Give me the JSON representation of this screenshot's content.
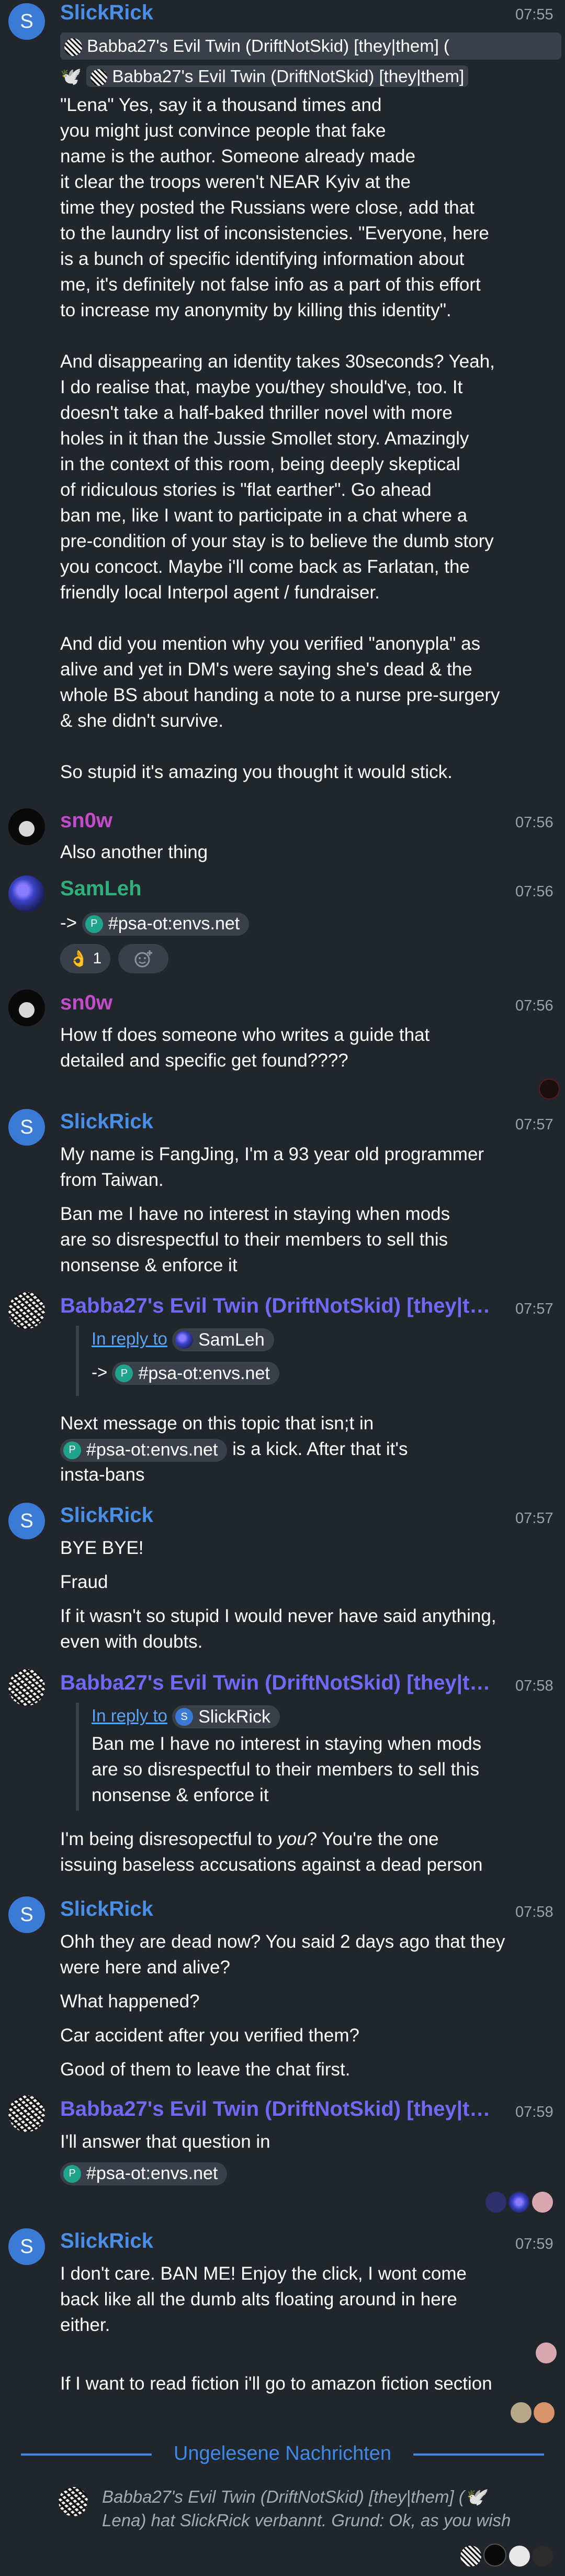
{
  "messages": {
    "m1": {
      "sender": "SlickRick",
      "avatar_letter": "S",
      "time": "07:55",
      "quote_line1": "Babba27's Evil Twin (DriftNotSkid) [they|them] (",
      "quote_line2": "Babba27's Evil Twin (DriftNotSkid) [they|them]",
      "p1": [
        "\"Lena\" Yes, say it a thousand times and",
        "you might just convince people that fake",
        "name is the author. Someone already made",
        "it clear the troops weren't NEAR Kyiv at the",
        "time they posted the Russians were close, add that",
        "to the laundry list of inconsistencies. \"Everyone, here",
        "is a bunch of specific identifying information about",
        "me, it's definitely not false info as a part of this effort",
        "to increase my anonymity by killing this identity\"."
      ],
      "p2": [
        "And disappearing an identity takes 30seconds? Yeah,",
        "I do realise that, maybe you/they should've, too. It",
        "doesn't take a half-baked thriller novel with more",
        "holes in it than the Jussie Smollet story. Amazingly",
        "in the context of this room, being deeply skeptical",
        "of ridiculous stories is \"flat earther\". Go ahead",
        "ban me, like I want to participate in a chat where a",
        "pre-condition of your stay is to believe the dumb story",
        "you concoct. Maybe i'll come back as Farlatan, the",
        "friendly local Interpol agent / fundraiser."
      ],
      "p3": [
        "And did you mention why you verified \"anonypla\" as",
        "alive and yet in DM's were saying she's dead & the",
        "whole BS about handing a note to a nurse pre-surgery",
        "& she didn't survive."
      ],
      "p4": "So stupid it's amazing you thought it would stick."
    },
    "m2": {
      "sender": "sn0w",
      "time": "07:56",
      "text": "Also another thing"
    },
    "m3": {
      "sender": "SamLeh",
      "time": "07:56",
      "prefix": "->",
      "room": "#psa-ot:envs.net",
      "reaction_emoji": "👌",
      "reaction_count": "1"
    },
    "m4": {
      "sender": "sn0w",
      "time": "07:56",
      "lines": [
        "How tf does someone who writes a guide that",
        "detailed and specific get found????"
      ]
    },
    "m5": {
      "sender": "SlickRick",
      "avatar_letter": "S",
      "time": "07:57",
      "a": [
        "My name is FangJing, I'm a 93 year old programmer",
        "from Taiwan."
      ],
      "b": [
        "Ban me I have no interest in staying when mods",
        "are so disrespectful to their members to sell this",
        "nonsense & enforce it"
      ]
    },
    "m6": {
      "sender": "Babba27's Evil Twin (DriftNotSkid) [they|the...",
      "time": "07:57",
      "reply_label": "In reply to",
      "reply_user": "SamLeh",
      "reply_prefix": "->",
      "reply_room": "#psa-ot:envs.net",
      "t1": "Next message on this topic that isn;t in",
      "room": "#psa-ot:envs.net",
      "t2": " is a kick. After that it's",
      "t3": "insta-bans"
    },
    "m7": {
      "sender": "SlickRick",
      "avatar_letter": "S",
      "time": "07:57",
      "a": "BYE BYE!",
      "b": "Fraud",
      "c": [
        "If it wasn't so stupid I would never have said anything,",
        "even with doubts."
      ]
    },
    "m8": {
      "sender": "Babba27's Evil Twin (DriftNotSkid) [they|the...",
      "time": "07:58",
      "reply_label": "In reply to",
      "reply_user": "SlickRick",
      "quote": [
        "Ban me I have no interest in staying when mods",
        "are so disrespectful to their members to sell this",
        "nonsense & enforce it"
      ],
      "t1": "I'm being disresopectful to ",
      "t1_em": "you",
      "t1_end": "? You're the one",
      "t2": "issuing baseless accusations against a dead person"
    },
    "m9": {
      "sender": "SlickRick",
      "avatar_letter": "S",
      "time": "07:58",
      "a": [
        "Ohh they are dead now? You said 2 days ago that they",
        "were here and alive?"
      ],
      "b": "What happened?",
      "c": "Car accident after you verified them?",
      "d": "Good of them to leave the chat first."
    },
    "m10": {
      "sender": "Babba27's Evil Twin (DriftNotSkid) [they|the...",
      "time": "07:59",
      "text": "I'll answer that question in",
      "room": "#psa-ot:envs.net"
    },
    "m11": {
      "sender": "SlickRick",
      "avatar_letter": "S",
      "time": "07:59",
      "a": [
        "I don't care. BAN ME! Enjoy the click, I wont come",
        "back like all the dumb alts floating around in here",
        "either."
      ],
      "b": "If I want to read fiction i'll go to amazon fiction section"
    }
  },
  "divider": {
    "label": "Ungelesene Nachrichten"
  },
  "event": {
    "line1": "Babba27's Evil Twin (DriftNotSkid) [they|them] (🕊️",
    "line2": "Lena) hat SlickRick verbannt. Grund: Ok, as you wish"
  },
  "colors": {
    "slickrick": "#4a8fe7",
    "sn0w": "#c24cc9",
    "samleh": "#2fb07a",
    "babba": "#6f6af5",
    "accent": "#3d8ae8",
    "background": "#21262c"
  }
}
